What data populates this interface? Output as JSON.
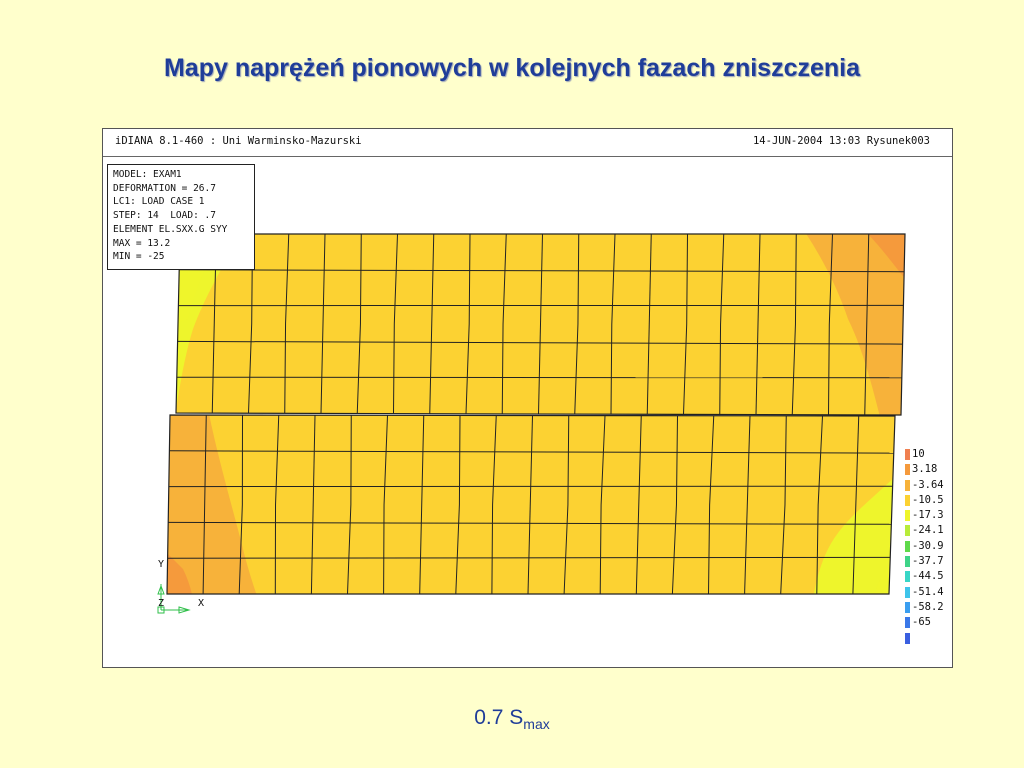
{
  "slide": {
    "title": "Mapy naprężeń pionowych w kolejnych fazach zniszczenia",
    "caption_main": "0.7 S",
    "caption_sub": "max"
  },
  "plot_window": {
    "header_left": "iDIANA 8.1-460 : Uni Warminsko-Mazurski",
    "header_right": "14-JUN-2004 13:03 Rysunek003",
    "info_lines": [
      "MODEL: EXAM1",
      "DEFORMATION = 26.7",
      "LC1: LOAD CASE 1",
      "STEP: 14  LOAD: .7",
      "ELEMENT EL.SXX.G SYY",
      "MAX = 13.2",
      "MIN = -25"
    ],
    "legend": [
      {
        "label": "10",
        "color": "#f08050"
      },
      {
        "label": "3.18",
        "color": "#f59a3c"
      },
      {
        "label": "-3.64",
        "color": "#f7b23a"
      },
      {
        "label": "-10.5",
        "color": "#fcd232"
      },
      {
        "label": "-17.3",
        "color": "#eef52c"
      },
      {
        "label": "-24.1",
        "color": "#b8ec3a"
      },
      {
        "label": "-30.9",
        "color": "#5fd94a"
      },
      {
        "label": "-37.7",
        "color": "#3ed488"
      },
      {
        "label": "-44.5",
        "color": "#38d6c6"
      },
      {
        "label": "-51.4",
        "color": "#3ec4ea"
      },
      {
        "label": "-58.2",
        "color": "#3a9ef0"
      },
      {
        "label": "-65",
        "color": "#3a78e8"
      },
      {
        "label": "",
        "color": "#3a5fe0"
      }
    ],
    "axes": {
      "y": "Y",
      "z": "Z",
      "x": "X"
    },
    "colors": {
      "base_fill": "#fcd232",
      "orange": "#f7b23a",
      "dark_orange": "#f59a3c",
      "yellow_green": "#eef52c",
      "grid": "#222222"
    }
  }
}
